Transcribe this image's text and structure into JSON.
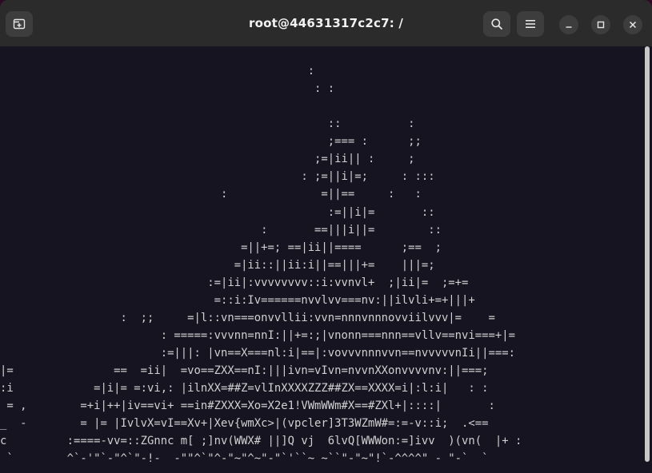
{
  "window": {
    "title": "root@44631317c2c7: /"
  },
  "titlebar": {
    "new_tab_icon": "new-tab-icon",
    "search_icon": "search-icon",
    "menu_icon": "hamburger-menu-icon",
    "minimize_icon": "minimize-icon",
    "maximize_icon": "maximize-icon",
    "close_icon": "close-icon"
  },
  "terminal": {
    "background": "#171421",
    "foreground": "#d0d0d0",
    "lines": [
      "                                              :",
      "                                               : :",
      "",
      "                                                 ::          :",
      "                                                 ;=== :      ;;",
      "                                               ;=|ii|| :     ;",
      "                                             : ;=||i|=;     : :::",
      "                                 :              =||==     :   :",
      "                                                 :=||i|=       ::",
      "                                       :       ==|||i||=        ::",
      "                                    =||+=; ==|ii||====      ;==  ;",
      "                                   =|ii::||ii:i||==|||+=    |||=;",
      "                               :=|ii|:vvvvvvvv::i:vvnvl+  ;|ii|=  ;=+=",
      "                                =::i:Iv======nvvlvv===nv:||ilvli+=+|||+",
      "                  :  ;;     =|l::vn===onvvllii:vvn=nnnvnnnovviilvvv|=    =",
      "                        : =====:vvvnn=nnI:||+=:;|vnonn===nnn==vllv==nvi===+|=",
      "                        :=|||: |vn==X===nl:i|==|:vovvvnnnvvn==nvvvvvnIi||===:",
      "|=               ==  =ii|  =vo==ZXX==nI:|||ivn=vIvn=nvvnXXonvvvvnv:||===;",
      ":i            =|i|= =:vi,: |ilnXX=##Z=vlInXXXXZZZ##ZX==XXXX=i|:l:i|   : :",
      " = ,        =+i|++|iv==vi+ ==in#ZXXX=Xo=X2e1!VWmWWm#X==#ZXl+|::::|       :",
      "_  -        = |= |IvlvX=vI==Xv+|Xev{wmXc>|(vpcler]3T3WZmW#=:=-v::i;  .<==",
      "c         :====-vv=::ZGnnc m[ ;]nv(WWX# ||]Q vj  6lvQ[WWWon:=]ivv  )(vn(  |+ :",
      " `        ^`-'\"`-\"^`\"-!-  -\"\"^`\"^-\"~\"^~\"-\"`'``~ ~``\"-\"~\"!`-^^^^\" - \"-`  `"
    ]
  }
}
